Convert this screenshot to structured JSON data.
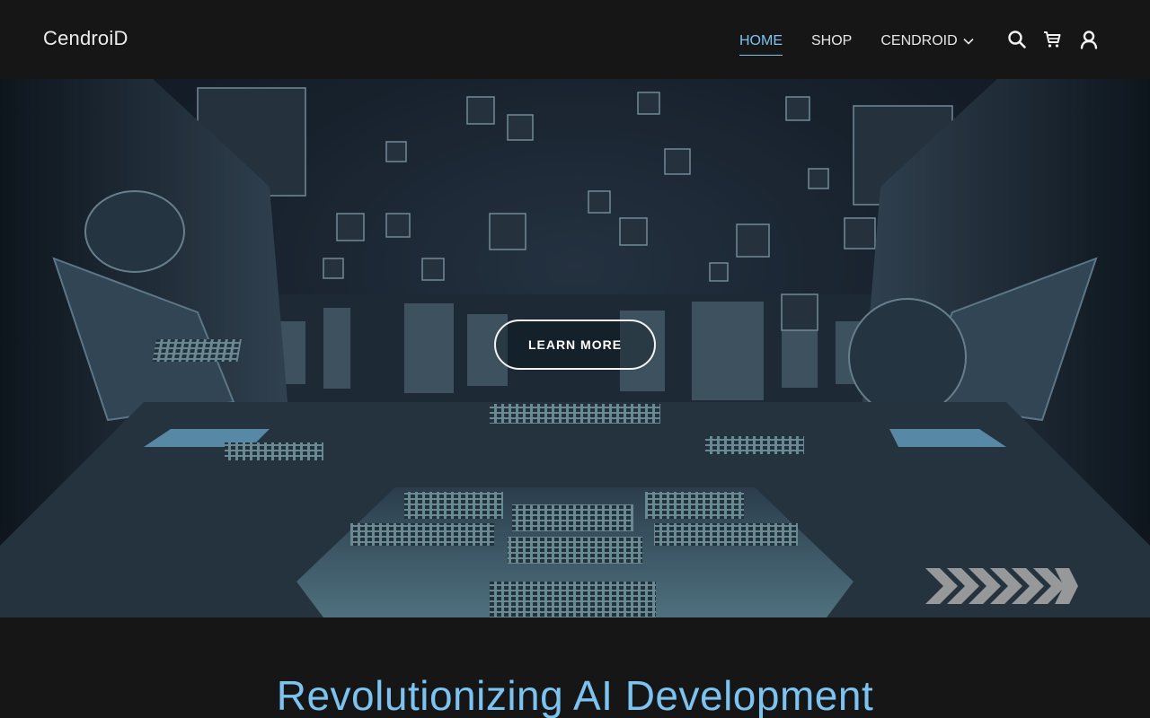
{
  "header": {
    "logo": "CendroiD",
    "nav": [
      {
        "label": "HOME",
        "active": true
      },
      {
        "label": "SHOP",
        "active": false
      },
      {
        "label": "CENDROID",
        "active": false,
        "has_dropdown": true
      }
    ],
    "icons": [
      "search-icon",
      "cart-icon",
      "account-icon"
    ]
  },
  "hero": {
    "button_label": "LEARN MORE"
  },
  "section": {
    "headline": "Revolutionizing AI Development"
  },
  "colors": {
    "background": "#161616",
    "accent": "#7cc3f0",
    "text": "#ffffff"
  }
}
